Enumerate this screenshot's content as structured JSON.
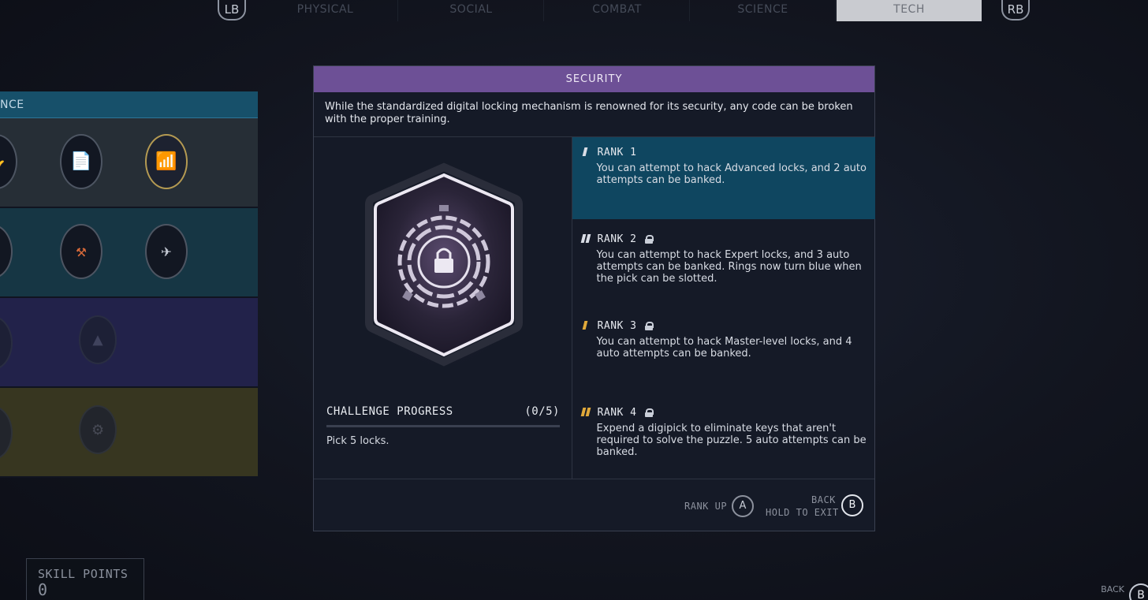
{
  "nav": {
    "prev_button": "LB",
    "next_button": "RB",
    "tabs": [
      {
        "label": "PHYSICAL"
      },
      {
        "label": "SOCIAL"
      },
      {
        "label": "COMBAT"
      },
      {
        "label": "SCIENCE"
      },
      {
        "label": "TECH",
        "active": true
      }
    ]
  },
  "tree": {
    "header": "NCE"
  },
  "skill_points": {
    "label": "SKILL POINTS",
    "value": "0"
  },
  "skill_panel": {
    "title": "SECURITY",
    "description": "While the standardized digital locking mechanism is renowned for its security, any code can be broken with the proper training.",
    "challenge": {
      "label": "CHALLENGE PROGRESS",
      "progress": "(0/5)",
      "task": "Pick 5 locks."
    },
    "ranks": [
      {
        "title": "RANK 1",
        "locked": false,
        "active": true,
        "bar_color": "#d9dde6",
        "text": "You can attempt to hack Advanced locks, and 2 auto attempts can be banked."
      },
      {
        "title": "RANK 2",
        "locked": true,
        "active": false,
        "bar_color": "#d9dde6",
        "text": "You can attempt to hack Expert locks, and 3 auto attempts can be banked. Rings now turn blue when the pick can be slotted."
      },
      {
        "title": "RANK 3",
        "locked": true,
        "active": false,
        "bar_color": "#e0a93a",
        "text": "You can attempt to hack Master-level locks, and 4 auto attempts can be banked."
      },
      {
        "title": "RANK 4",
        "locked": true,
        "active": false,
        "bar_color": "#e0a93a",
        "text": "Expend a digipick to eliminate keys that aren't required to solve the puzzle. 5 auto attempts can be banked."
      }
    ],
    "footer": {
      "rank_up_label": "RANK UP",
      "rank_up_button": "A",
      "back_label": "BACK",
      "hold_label": "HOLD TO EXIT",
      "back_button": "B"
    }
  },
  "corner": {
    "back_label": "BACK",
    "back_button": "B"
  },
  "colors": {
    "title_bar": "#6d5096",
    "active_rank": "#0f4660",
    "gold_rank": "#e0a93a"
  }
}
